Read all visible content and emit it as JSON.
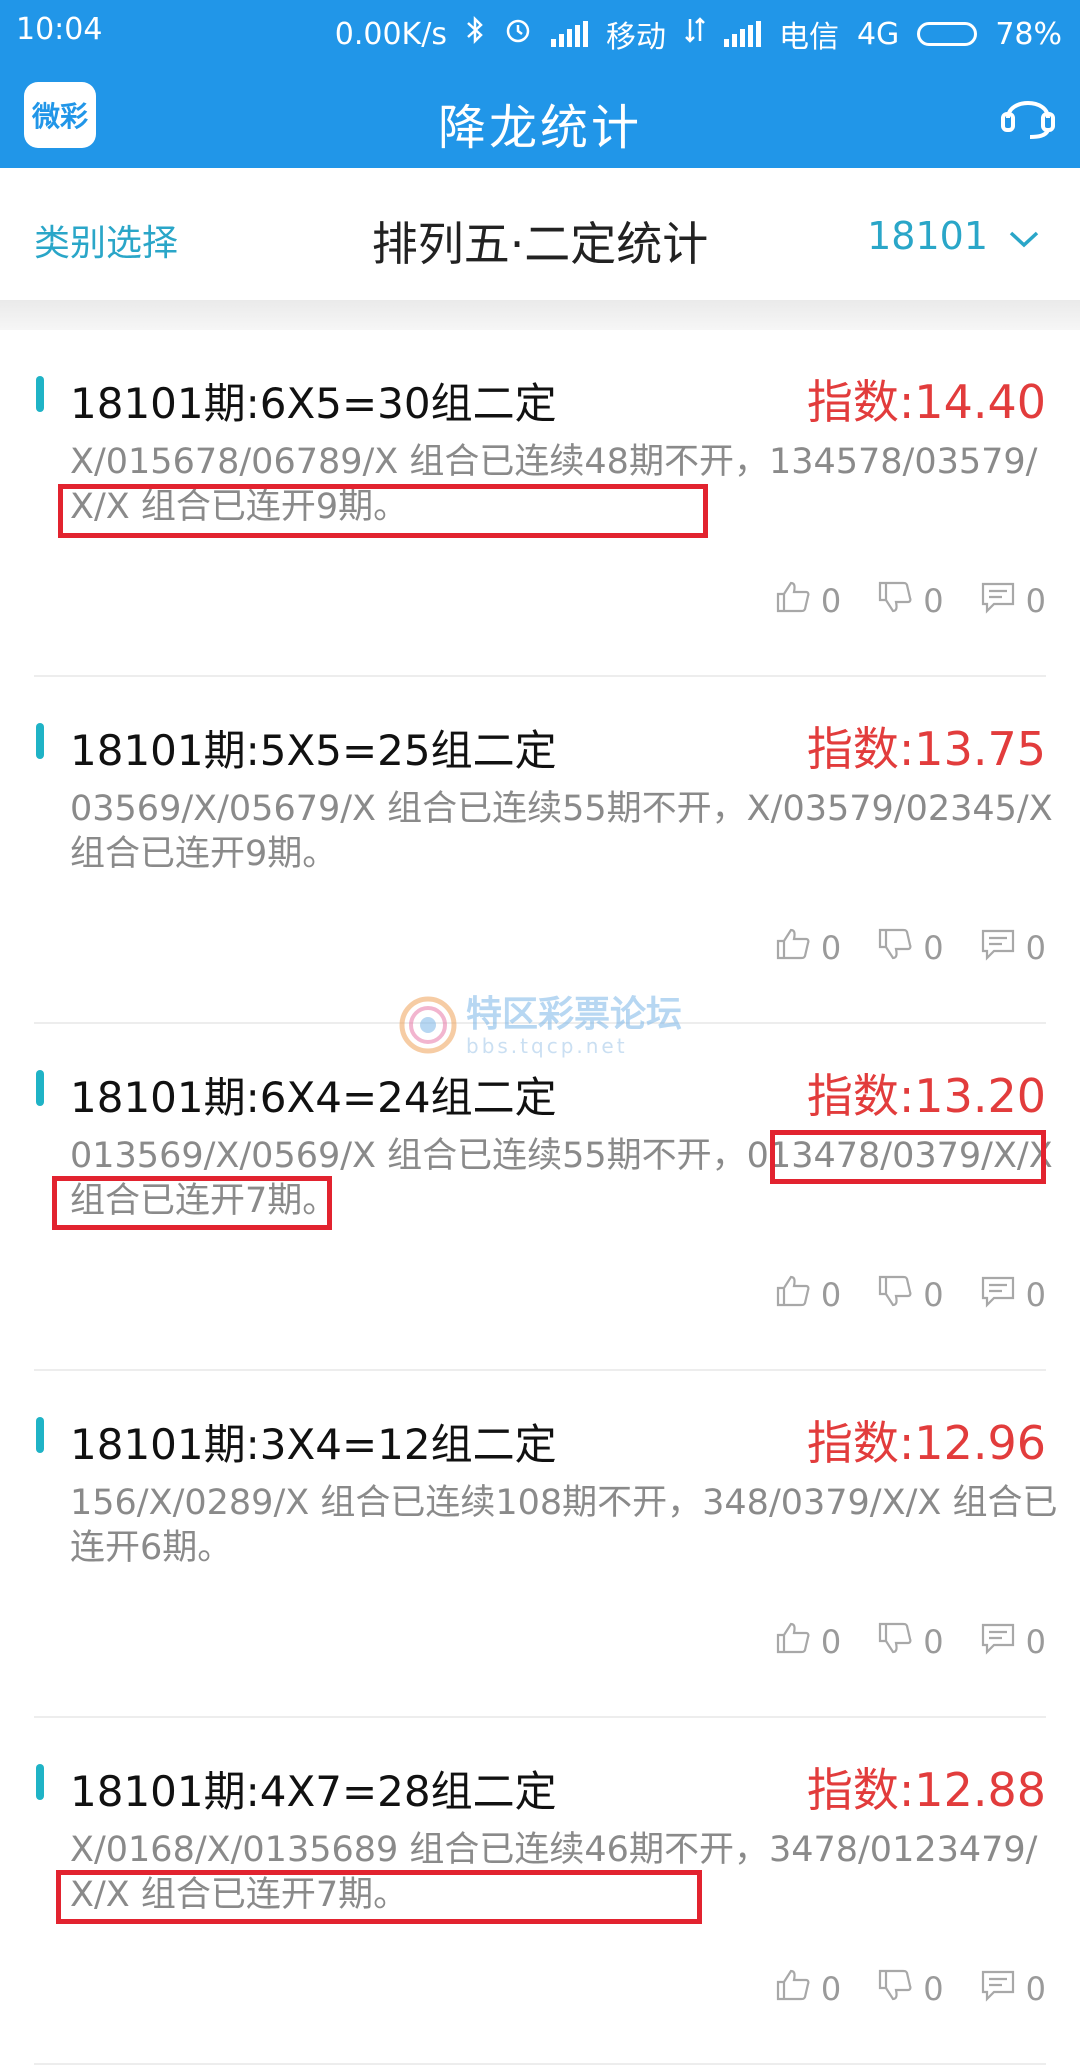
{
  "status_bar": {
    "time": "10:04",
    "speed": "0.00K/s",
    "carrier1": "移动",
    "carrier2": "电信",
    "network": "4G",
    "battery": "78%",
    "battery_level": 0.78
  },
  "nav": {
    "logo_text": "微彩",
    "title": "降龙统计"
  },
  "filter": {
    "category_label": "类别选择",
    "title": "排列五·二定统计",
    "issue": "18101"
  },
  "watermark": {
    "name": "特区彩票论坛",
    "url": "bbs.tqcp.net"
  },
  "cards": [
    {
      "head": "18101期:6X5=30组二定",
      "index": "指数:14.40",
      "desc": "X/015678/06789/X 组合已连续48期不开，134578/03579/X/X 组合已连开9期。",
      "likes": "0",
      "dislikes": "0",
      "comments": "0"
    },
    {
      "head": "18101期:5X5=25组二定",
      "index": "指数:13.75",
      "desc": "03569/X/05679/X 组合已连续55期不开，X/03579/02345/X 组合已连开9期。",
      "likes": "0",
      "dislikes": "0",
      "comments": "0"
    },
    {
      "head": "18101期:6X4=24组二定",
      "index": "指数:13.20",
      "desc": "013569/X/0569/X 组合已连续55期不开，013478/0379/X/X 组合已连开7期。",
      "likes": "0",
      "dislikes": "0",
      "comments": "0"
    },
    {
      "head": "18101期:3X4=12组二定",
      "index": "指数:12.96",
      "desc": "156/X/0289/X 组合已连续108期不开，348/0379/X/X 组合已连开6期。",
      "likes": "0",
      "dislikes": "0",
      "comments": "0"
    },
    {
      "head": "18101期:4X7=28组二定",
      "index": "指数:12.88",
      "desc": "X/0168/X/0135689 组合已连续46期不开，3478/0123479/X/X 组合已连开7期。",
      "likes": "0",
      "dislikes": "0",
      "comments": "0"
    }
  ],
  "colors": {
    "primary": "#2196e8",
    "accent": "#2aa6c8",
    "index_red": "#e23c3c",
    "highlight_red": "#e2232f"
  }
}
